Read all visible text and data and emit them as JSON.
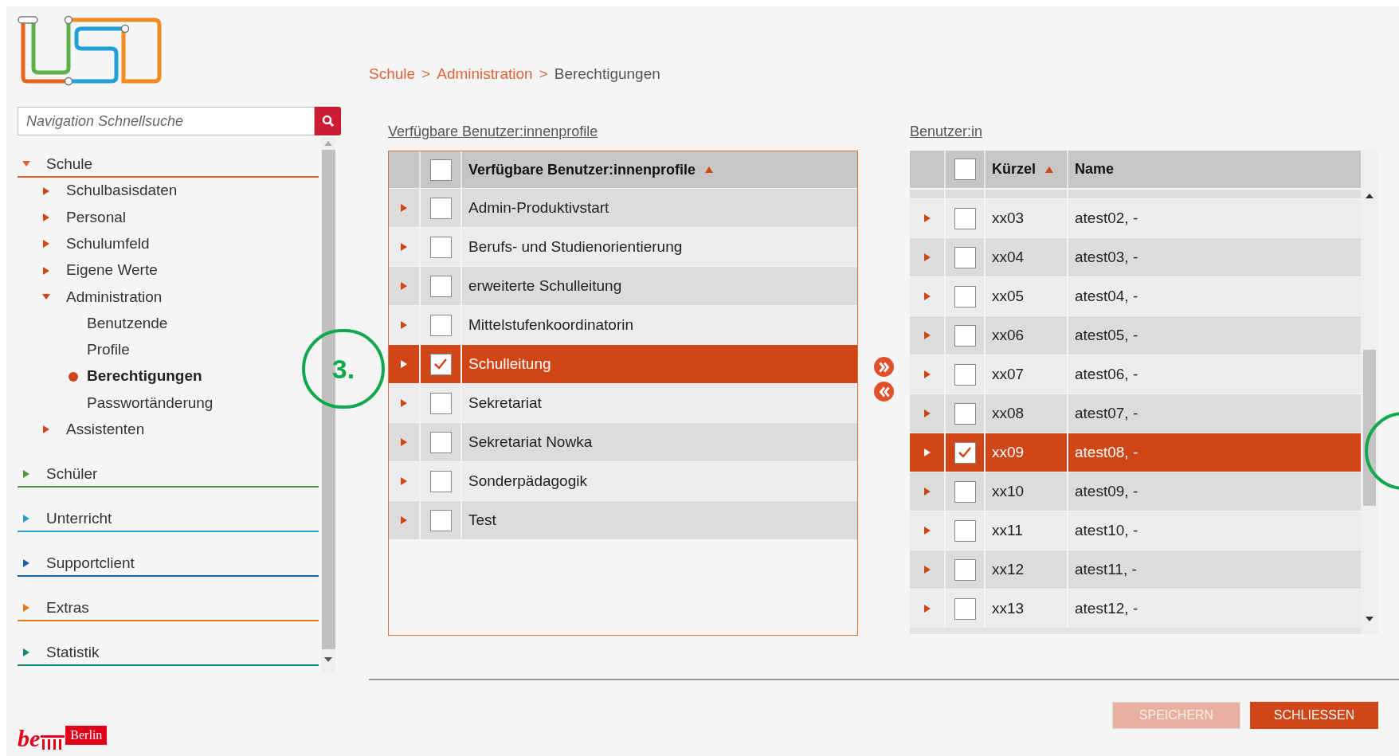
{
  "search": {
    "placeholder": "Navigation Schnellsuche"
  },
  "nav": [
    {
      "label": "Schule",
      "color": "#e0602a",
      "expanded": true,
      "children": [
        {
          "label": "Schulbasisdaten",
          "kind": "folder",
          "expanded": false
        },
        {
          "label": "Personal",
          "kind": "folder",
          "expanded": false
        },
        {
          "label": "Schulumfeld",
          "kind": "folder",
          "expanded": false
        },
        {
          "label": "Eigene Werte",
          "kind": "folder",
          "expanded": false
        },
        {
          "label": "Administration",
          "kind": "folder",
          "expanded": true,
          "children": [
            {
              "label": "Benutzende",
              "kind": "page",
              "selected": false
            },
            {
              "label": "Profile",
              "kind": "page",
              "selected": false
            },
            {
              "label": "Berechtigungen",
              "kind": "page",
              "selected": true
            },
            {
              "label": "Passwortänderung",
              "kind": "page",
              "selected": false
            }
          ]
        },
        {
          "label": "Assistenten",
          "kind": "folder",
          "expanded": false
        }
      ]
    },
    {
      "label": "Schüler",
      "color": "#4a9a3a",
      "expanded": false
    },
    {
      "label": "Unterricht",
      "color": "#2a9fd0",
      "expanded": false
    },
    {
      "label": "Supportclient",
      "color": "#1560b0",
      "expanded": false
    },
    {
      "label": "Extras",
      "color": "#e87a1a",
      "expanded": false
    },
    {
      "label": "Statistik",
      "color": "#12877a",
      "expanded": false
    }
  ],
  "breadcrumb": [
    {
      "kind": "link",
      "label": "Schule"
    },
    {
      "kind": "separator",
      "label": ">"
    },
    {
      "kind": "link",
      "label": "Administration"
    },
    {
      "kind": "separator",
      "label": ">"
    },
    {
      "kind": "current",
      "label": "Berechtigungen"
    }
  ],
  "profiles": {
    "title": "Verfügbare Benutzer:innenprofile",
    "column": {
      "label": "Verfügbare Benutzer:innenprofile",
      "sorted_ascending": true
    },
    "all_checked": false,
    "rows": [
      {
        "label": "Admin-Produktivstart",
        "checked": false,
        "selected": false
      },
      {
        "label": "Berufs- und Studienorientierung",
        "checked": false,
        "selected": false
      },
      {
        "label": "erweiterte Schulleitung",
        "checked": false,
        "selected": false
      },
      {
        "label": "Mittelstufenkoordinatorin",
        "checked": false,
        "selected": false
      },
      {
        "label": "Schulleitung",
        "checked": true,
        "selected": true
      },
      {
        "label": "Sekretariat",
        "checked": false,
        "selected": false
      },
      {
        "label": "Sekretariat Nowka",
        "checked": false,
        "selected": false
      },
      {
        "label": "Sonderpädagogik",
        "checked": false,
        "selected": false
      },
      {
        "label": "Test",
        "checked": false,
        "selected": false
      }
    ]
  },
  "users": {
    "title": "Benutzer:in",
    "all_checked": false,
    "columns": [
      {
        "label": "Kürzel",
        "sorted_ascending": true
      },
      {
        "label": "Name",
        "sorted_ascending": false
      }
    ],
    "rows": [
      {
        "kuerzel": "xx03",
        "name": "atest02, -",
        "checked": false,
        "selected": false
      },
      {
        "kuerzel": "xx04",
        "name": "atest03, -",
        "checked": false,
        "selected": false
      },
      {
        "kuerzel": "xx05",
        "name": "atest04, -",
        "checked": false,
        "selected": false
      },
      {
        "kuerzel": "xx06",
        "name": "atest05, -",
        "checked": false,
        "selected": false
      },
      {
        "kuerzel": "xx07",
        "name": "atest06, -",
        "checked": false,
        "selected": false
      },
      {
        "kuerzel": "xx08",
        "name": "atest07, -",
        "checked": false,
        "selected": false
      },
      {
        "kuerzel": "xx09",
        "name": "atest08, -",
        "checked": true,
        "selected": true
      },
      {
        "kuerzel": "xx10",
        "name": "atest09, -",
        "checked": false,
        "selected": false
      },
      {
        "kuerzel": "xx11",
        "name": "atest10, -",
        "checked": false,
        "selected": false
      },
      {
        "kuerzel": "xx12",
        "name": "atest11, -",
        "checked": false,
        "selected": false
      },
      {
        "kuerzel": "xx13",
        "name": "atest12, -",
        "checked": false,
        "selected": false
      }
    ]
  },
  "buttons": [
    {
      "label": "SPEICHERN",
      "disabled": true
    },
    {
      "label": "SCHLIESSEN",
      "disabled": false
    }
  ],
  "footer_logo": {
    "mark": "be",
    "label": "Berlin"
  },
  "annotations": [
    {
      "kind": "numbered",
      "label": "3."
    },
    {
      "kind": "plain"
    }
  ]
}
